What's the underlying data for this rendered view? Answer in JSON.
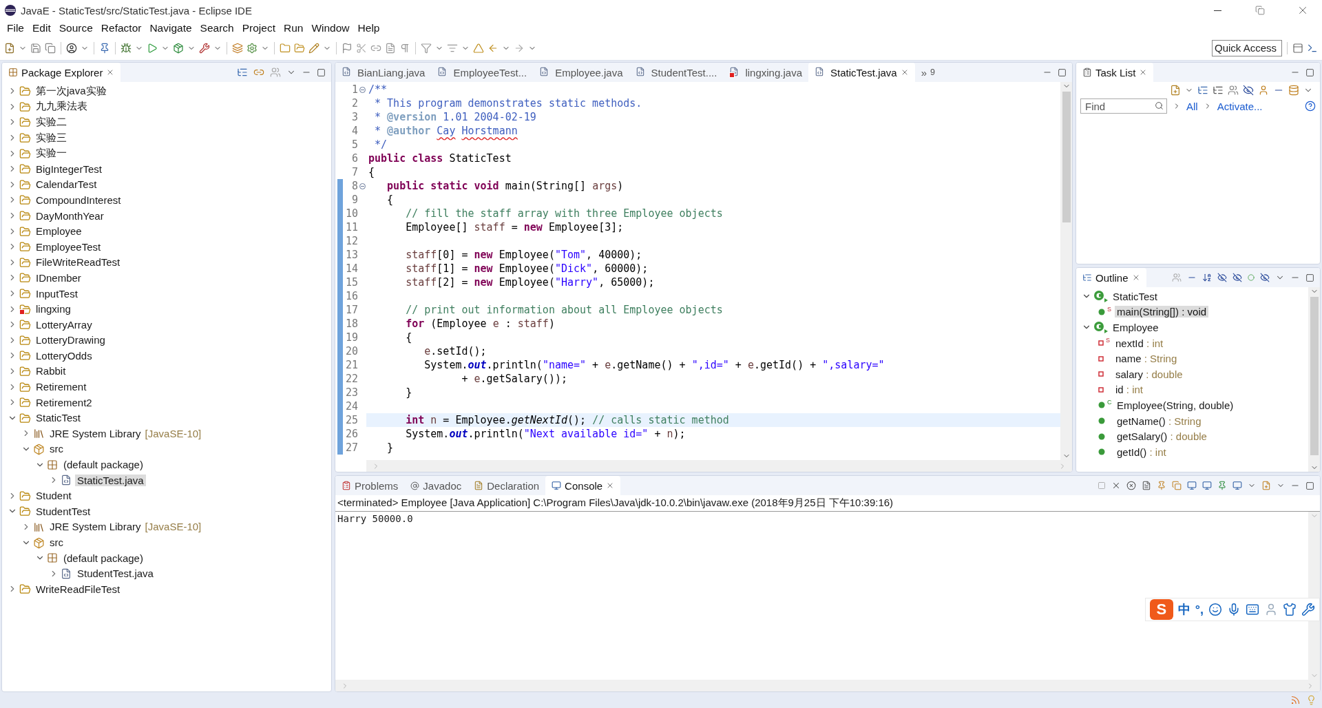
{
  "window": {
    "title": "JavaE - StaticTest/src/StaticTest.java - Eclipse IDE"
  },
  "menu": [
    "File",
    "Edit",
    "Source",
    "Refactor",
    "Navigate",
    "Search",
    "Project",
    "Run",
    "Window",
    "Help"
  ],
  "quick_access": {
    "placeholder": "Quick Access"
  },
  "explorer": {
    "title": "Package Explorer",
    "items": [
      {
        "label": "第一次java实验",
        "kind": "project",
        "expanded": false,
        "selected": false,
        "error": false
      },
      {
        "label": "九九乘法表",
        "kind": "project",
        "expanded": false,
        "selected": false,
        "error": false
      },
      {
        "label": "实验二",
        "kind": "project",
        "expanded": false,
        "selected": false,
        "error": false
      },
      {
        "label": "实验三",
        "kind": "project",
        "expanded": false,
        "selected": false,
        "error": false
      },
      {
        "label": "实验一",
        "kind": "project",
        "expanded": false,
        "selected": false,
        "error": false
      },
      {
        "label": "BigIntegerTest",
        "kind": "project",
        "expanded": false,
        "selected": false,
        "error": false
      },
      {
        "label": "CalendarTest",
        "kind": "project",
        "expanded": false,
        "selected": false,
        "error": false
      },
      {
        "label": "CompoundInterest",
        "kind": "project",
        "expanded": false,
        "selected": false,
        "error": false
      },
      {
        "label": "DayMonthYear",
        "kind": "project",
        "expanded": false,
        "selected": false,
        "error": false
      },
      {
        "label": "Employee",
        "kind": "project",
        "expanded": false,
        "selected": false,
        "error": false
      },
      {
        "label": "EmployeeTest",
        "kind": "project",
        "expanded": false,
        "selected": false,
        "error": false
      },
      {
        "label": "FileWriteReadTest",
        "kind": "project",
        "expanded": false,
        "selected": false,
        "error": false
      },
      {
        "label": "IDnember",
        "kind": "project",
        "expanded": false,
        "selected": false,
        "error": false
      },
      {
        "label": "InputTest",
        "kind": "project",
        "expanded": false,
        "selected": false,
        "error": false
      },
      {
        "label": "lingxing",
        "kind": "project",
        "expanded": false,
        "selected": false,
        "error": true
      },
      {
        "label": "LotteryArray",
        "kind": "project",
        "expanded": false,
        "selected": false,
        "error": false
      },
      {
        "label": "LotteryDrawing",
        "kind": "project",
        "expanded": false,
        "selected": false,
        "error": false
      },
      {
        "label": "LotteryOdds",
        "kind": "project",
        "expanded": false,
        "selected": false,
        "error": false
      },
      {
        "label": "Rabbit",
        "kind": "project",
        "expanded": false,
        "selected": false,
        "error": false
      },
      {
        "label": "Retirement",
        "kind": "project",
        "expanded": false,
        "selected": false,
        "error": false
      },
      {
        "label": "Retirement2",
        "kind": "project",
        "expanded": false,
        "selected": false,
        "error": false
      },
      {
        "label": "StaticTest",
        "kind": "project",
        "expanded": true,
        "selected": false,
        "error": false,
        "children": [
          {
            "label": "JRE System Library",
            "suffix": "[JavaSE-10]",
            "kind": "library",
            "expanded": false,
            "selected": false,
            "error": false
          },
          {
            "label": "src",
            "kind": "src",
            "expanded": true,
            "selected": false,
            "error": false,
            "children": [
              {
                "label": "(default package)",
                "kind": "package",
                "expanded": true,
                "selected": false,
                "error": false,
                "children": [
                  {
                    "label": "StaticTest.java",
                    "kind": "file",
                    "expanded": false,
                    "selected": true,
                    "error": false
                  }
                ]
              }
            ]
          }
        ]
      },
      {
        "label": "Student",
        "kind": "project",
        "expanded": false,
        "selected": false,
        "error": false
      },
      {
        "label": "StudentTest",
        "kind": "project",
        "expanded": true,
        "selected": false,
        "error": false,
        "children": [
          {
            "label": "JRE System Library",
            "suffix": "[JavaSE-10]",
            "kind": "library",
            "expanded": false,
            "selected": false,
            "error": false
          },
          {
            "label": "src",
            "kind": "src",
            "expanded": true,
            "selected": false,
            "error": false,
            "children": [
              {
                "label": "(default package)",
                "kind": "package",
                "expanded": true,
                "selected": false,
                "error": false,
                "children": [
                  {
                    "label": "StudentTest.java",
                    "kind": "file",
                    "expanded": false,
                    "selected": false,
                    "error": false
                  }
                ]
              }
            ]
          }
        ]
      },
      {
        "label": "WriteReadFileTest",
        "kind": "project",
        "expanded": false,
        "selected": false,
        "error": false
      }
    ]
  },
  "editor": {
    "tabs": [
      {
        "label": "BianLiang.java",
        "selected": false,
        "error": false
      },
      {
        "label": "EmployeeTest...",
        "selected": false,
        "error": false
      },
      {
        "label": "Employee.java",
        "selected": false,
        "error": false
      },
      {
        "label": "StudentTest....",
        "selected": false,
        "error": false
      },
      {
        "label": "lingxing.java",
        "selected": false,
        "error": true
      },
      {
        "label": "StaticTest.java",
        "selected": true,
        "error": false
      }
    ],
    "overflow": "»",
    "hidden_count": "9",
    "lines": [
      {
        "number": "1",
        "fold": true,
        "current": false,
        "range": false,
        "segments": [
          {
            "kind": "javadoc",
            "text": "/**"
          }
        ]
      },
      {
        "number": "2",
        "fold": false,
        "current": false,
        "range": false,
        "segments": [
          {
            "kind": "javadoc",
            "text": " * This program demonstrates static methods."
          }
        ]
      },
      {
        "number": "3",
        "fold": false,
        "current": false,
        "range": false,
        "segments": [
          {
            "kind": "javadoc",
            "text": " * "
          },
          {
            "kind": "tag",
            "text": "@version"
          },
          {
            "kind": "javadoc",
            "text": " 1.01 2004-02-19"
          }
        ]
      },
      {
        "number": "4",
        "fold": false,
        "current": false,
        "range": false,
        "segments": [
          {
            "kind": "javadoc",
            "text": " * "
          },
          {
            "kind": "tag",
            "text": "@author "
          },
          {
            "kind": "typo",
            "text": "Cay Horstmann"
          }
        ]
      },
      {
        "number": "5",
        "fold": false,
        "current": false,
        "range": false,
        "segments": [
          {
            "kind": "javadoc",
            "text": " */"
          }
        ]
      },
      {
        "number": "6",
        "fold": false,
        "current": false,
        "range": false,
        "segments": [
          {
            "kind": "keyword",
            "text": "public class"
          },
          {
            "kind": "plain",
            "text": " StaticTest"
          }
        ]
      },
      {
        "number": "7",
        "fold": false,
        "current": false,
        "range": false,
        "segments": [
          {
            "kind": "plain",
            "text": "{"
          }
        ]
      },
      {
        "number": "8",
        "fold": true,
        "current": false,
        "range": true,
        "segments": [
          {
            "kind": "keyword",
            "text": "   public static void"
          },
          {
            "kind": "plain",
            "text": " main(String[] "
          },
          {
            "kind": "var",
            "text": "args"
          },
          {
            "kind": "plain",
            "text": ")"
          }
        ]
      },
      {
        "number": "9",
        "fold": false,
        "current": false,
        "range": true,
        "segments": [
          {
            "kind": "plain",
            "text": "   {"
          }
        ]
      },
      {
        "number": "10",
        "fold": false,
        "current": false,
        "range": true,
        "segments": [
          {
            "kind": "comment",
            "text": "      // fill the staff array with three Employee objects"
          }
        ]
      },
      {
        "number": "11",
        "fold": false,
        "current": false,
        "range": true,
        "segments": [
          {
            "kind": "plain",
            "text": "      Employee[] "
          },
          {
            "kind": "var",
            "text": "staff"
          },
          {
            "kind": "plain",
            "text": " = "
          },
          {
            "kind": "keyword",
            "text": "new"
          },
          {
            "kind": "plain",
            "text": " Employee[3];"
          }
        ]
      },
      {
        "number": "12",
        "fold": false,
        "current": false,
        "range": true
      },
      {
        "number": "13",
        "fold": false,
        "current": false,
        "range": true,
        "segments": [
          {
            "kind": "var",
            "text": "      staff"
          },
          {
            "kind": "plain",
            "text": "[0] = "
          },
          {
            "kind": "keyword",
            "text": "new"
          },
          {
            "kind": "plain",
            "text": " Employee("
          },
          {
            "kind": "string",
            "text": "\"Tom\""
          },
          {
            "kind": "plain",
            "text": ", 40000);"
          }
        ]
      },
      {
        "number": "14",
        "fold": false,
        "current": false,
        "range": true,
        "segments": [
          {
            "kind": "var",
            "text": "      staff"
          },
          {
            "kind": "plain",
            "text": "[1] = "
          },
          {
            "kind": "keyword",
            "text": "new"
          },
          {
            "kind": "plain",
            "text": " Employee("
          },
          {
            "kind": "string",
            "text": "\"Dick\""
          },
          {
            "kind": "plain",
            "text": ", 60000);"
          }
        ]
      },
      {
        "number": "15",
        "fold": false,
        "current": false,
        "range": true,
        "segments": [
          {
            "kind": "var",
            "text": "      staff"
          },
          {
            "kind": "plain",
            "text": "[2] = "
          },
          {
            "kind": "keyword",
            "text": "new"
          },
          {
            "kind": "plain",
            "text": " Employee("
          },
          {
            "kind": "string",
            "text": "\"Harry\""
          },
          {
            "kind": "plain",
            "text": ", 65000);"
          }
        ]
      },
      {
        "number": "16",
        "fold": false,
        "current": false,
        "range": true
      },
      {
        "number": "17",
        "fold": false,
        "current": false,
        "range": true,
        "segments": [
          {
            "kind": "comment",
            "text": "      // print out information about all Employee objects"
          }
        ]
      },
      {
        "number": "18",
        "fold": false,
        "current": false,
        "range": true,
        "segments": [
          {
            "kind": "keyword",
            "text": "      for"
          },
          {
            "kind": "plain",
            "text": " (Employee "
          },
          {
            "kind": "var",
            "text": "e"
          },
          {
            "kind": "plain",
            "text": " : "
          },
          {
            "kind": "var",
            "text": "staff"
          },
          {
            "kind": "plain",
            "text": ")"
          }
        ]
      },
      {
        "number": "19",
        "fold": false,
        "current": false,
        "range": true,
        "segments": [
          {
            "kind": "plain",
            "text": "      {"
          }
        ]
      },
      {
        "number": "20",
        "fold": false,
        "current": false,
        "range": true,
        "segments": [
          {
            "kind": "var",
            "text": "         e"
          },
          {
            "kind": "plain",
            "text": ".setId();"
          }
        ]
      },
      {
        "number": "21",
        "fold": false,
        "current": false,
        "range": true,
        "segments": [
          {
            "kind": "plain",
            "text": "         System."
          },
          {
            "kind": "static_field",
            "text": "out"
          },
          {
            "kind": "plain",
            "text": ".println("
          },
          {
            "kind": "string",
            "text": "\"name=\""
          },
          {
            "kind": "plain",
            "text": " + "
          },
          {
            "kind": "var",
            "text": "e"
          },
          {
            "kind": "plain",
            "text": ".getName() + "
          },
          {
            "kind": "string",
            "text": "\",id=\""
          },
          {
            "kind": "plain",
            "text": " + "
          },
          {
            "kind": "var",
            "text": "e"
          },
          {
            "kind": "plain",
            "text": ".getId() + "
          },
          {
            "kind": "string",
            "text": "\",salary=\""
          }
        ]
      },
      {
        "number": "22",
        "fold": false,
        "current": false,
        "range": true,
        "segments": [
          {
            "kind": "plain",
            "text": "               + "
          },
          {
            "kind": "var",
            "text": "e"
          },
          {
            "kind": "plain",
            "text": ".getSalary());"
          }
        ]
      },
      {
        "number": "23",
        "fold": false,
        "current": false,
        "range": true,
        "segments": [
          {
            "kind": "plain",
            "text": "      }"
          }
        ]
      },
      {
        "number": "24",
        "fold": false,
        "current": false,
        "range": true
      },
      {
        "number": "25",
        "fold": false,
        "current": true,
        "range": true,
        "segments": [
          {
            "kind": "keyword",
            "text": "      int "
          },
          {
            "kind": "var",
            "text": "n"
          },
          {
            "kind": "plain",
            "text": " = Employee."
          },
          {
            "kind": "static_method",
            "text": "getNextId"
          },
          {
            "kind": "plain",
            "text": "(); "
          },
          {
            "kind": "comment",
            "text": "// calls static method"
          }
        ]
      },
      {
        "number": "26",
        "fold": false,
        "current": false,
        "range": true,
        "segments": [
          {
            "kind": "plain",
            "text": "      System."
          },
          {
            "kind": "static_field",
            "text": "out"
          },
          {
            "kind": "plain",
            "text": ".println("
          },
          {
            "kind": "string",
            "text": "\"Next available id=\""
          },
          {
            "kind": "plain",
            "text": " + "
          },
          {
            "kind": "var",
            "text": "n"
          },
          {
            "kind": "plain",
            "text": ");"
          }
        ]
      },
      {
        "number": "27",
        "fold": false,
        "current": false,
        "range": true,
        "segments": [
          {
            "kind": "plain",
            "text": "   }"
          }
        ]
      }
    ]
  },
  "task_list": {
    "title": "Task List",
    "find": {
      "placeholder": "Find"
    },
    "links": [
      "All",
      "Activate..."
    ]
  },
  "outline": {
    "title": "Outline",
    "items": [
      {
        "label": "StaticTest",
        "kind": "class",
        "expanded": true,
        "selected": false,
        "children": [
          {
            "label": "main(String[])",
            "type": " : void",
            "kind": "method",
            "badge": "S",
            "selected": true
          }
        ]
      },
      {
        "label": "Employee",
        "kind": "class",
        "expanded": true,
        "selected": false,
        "children": [
          {
            "label": "nextId",
            "type": " : int",
            "kind": "field",
            "badge": "S",
            "selected": false
          },
          {
            "label": "name",
            "type": " : String",
            "kind": "field",
            "selected": false
          },
          {
            "label": "salary",
            "type": " : double",
            "kind": "field",
            "selected": false
          },
          {
            "label": "id",
            "type": " : int",
            "kind": "field",
            "selected": false
          },
          {
            "label": "Employee(String, double)",
            "kind": "method",
            "badge": "C",
            "selected": false
          },
          {
            "label": "getName()",
            "type": " : String",
            "kind": "method",
            "selected": false
          },
          {
            "label": "getSalary()",
            "type": " : double",
            "kind": "method",
            "selected": false
          },
          {
            "label": "getId()",
            "type": " : int",
            "kind": "method",
            "selected": false
          }
        ]
      }
    ]
  },
  "console": {
    "tabs": [
      {
        "label": "Problems",
        "kind": "problems",
        "selected": false
      },
      {
        "label": "Javadoc",
        "kind": "javadoc",
        "selected": false
      },
      {
        "label": "Declaration",
        "kind": "declaration",
        "selected": false
      },
      {
        "label": "Console",
        "kind": "console",
        "selected": true
      }
    ],
    "header": "<terminated> Employee [Java Application] C:\\Program Files\\Java\\jdk-10.0.2\\bin\\javaw.exe (2018年9月25日 下午10:39:16)",
    "output": [
      "Harry 50000.0"
    ]
  },
  "ime": {
    "logo": "S",
    "mode": "中",
    "punct": "°,"
  }
}
